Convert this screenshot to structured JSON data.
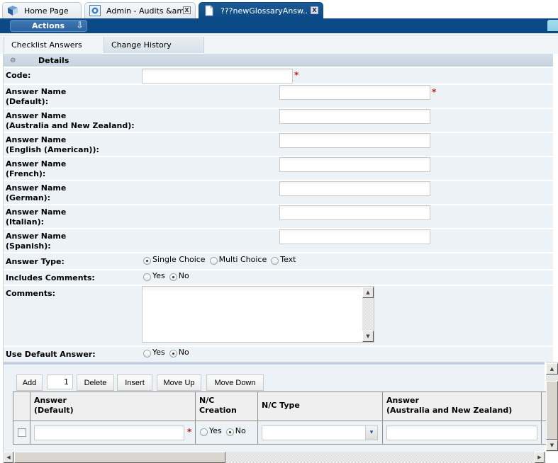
{
  "tabs": [
    {
      "label": "Home Page",
      "icon": "home-cube-icon",
      "closable": false,
      "active": false
    },
    {
      "label": "Admin - Audits &am..",
      "icon": "gear-icon",
      "closable": true,
      "active": false
    },
    {
      "label": "???newGlossaryAnsw..",
      "icon": "document-icon",
      "closable": true,
      "active": true
    }
  ],
  "close_glyph": "X",
  "actions": {
    "label": "Actions",
    "arrow": "⇩"
  },
  "subtabs": [
    {
      "label": "Checklist Answers",
      "selected": true
    },
    {
      "label": "Change History",
      "selected": false
    }
  ],
  "details": {
    "collapse_glyph": "⊖",
    "title": "Details",
    "code": {
      "label": "Code:",
      "value": "",
      "required": true
    },
    "answer_names": [
      {
        "label_1": "Answer Name",
        "label_2": "(Default):",
        "value": "",
        "required": true
      },
      {
        "label_1": "Answer Name",
        "label_2": "(Australia and New Zealand):",
        "value": "",
        "required": false
      },
      {
        "label_1": "Answer Name",
        "label_2": "(English (American)):",
        "value": "",
        "required": false
      },
      {
        "label_1": "Answer Name",
        "label_2": "(French):",
        "value": "",
        "required": false
      },
      {
        "label_1": "Answer Name",
        "label_2": "(German):",
        "value": "",
        "required": false
      },
      {
        "label_1": "Answer Name",
        "label_2": "(Italian):",
        "value": "",
        "required": false
      },
      {
        "label_1": "Answer Name",
        "label_2": "(Spanish):",
        "value": "",
        "required": false
      }
    ],
    "required_mark": "*",
    "answer_type": {
      "label": "Answer Type:",
      "options": [
        "Single Choice",
        "Multi Choice",
        "Text"
      ],
      "selected": "Single Choice"
    },
    "includes_comments": {
      "label": "Includes Comments:",
      "options": [
        "Yes",
        "No"
      ],
      "selected": "No"
    },
    "comments": {
      "label": "Comments:",
      "value": ""
    },
    "use_default_answer": {
      "label": "Use Default Answer:",
      "options": [
        "Yes",
        "No"
      ],
      "selected": "No"
    }
  },
  "grid": {
    "buttons": {
      "add": "Add",
      "count": "1",
      "delete": "Delete",
      "insert": "Insert",
      "move_up": "Move Up",
      "move_down": "Move Down"
    },
    "columns": [
      {
        "line1": "",
        "line2": ""
      },
      {
        "line1": "Answer",
        "line2": "(Default)"
      },
      {
        "line1": "N/C",
        "line2": "Creation"
      },
      {
        "line1": "N/C Type",
        "line2": ""
      },
      {
        "line1": "Answer",
        "line2": "(Australia and New Zealand)"
      }
    ],
    "rows": [
      {
        "checked": false,
        "answer_default": "",
        "nc_creation_options": [
          "Yes",
          "No"
        ],
        "nc_creation": "No",
        "nc_type": "",
        "answer_anz": ""
      }
    ]
  },
  "scroll_glyphs": {
    "up": "▲",
    "down": "▼",
    "left": "◀",
    "right": "▶",
    "dropdown": "▾"
  }
}
